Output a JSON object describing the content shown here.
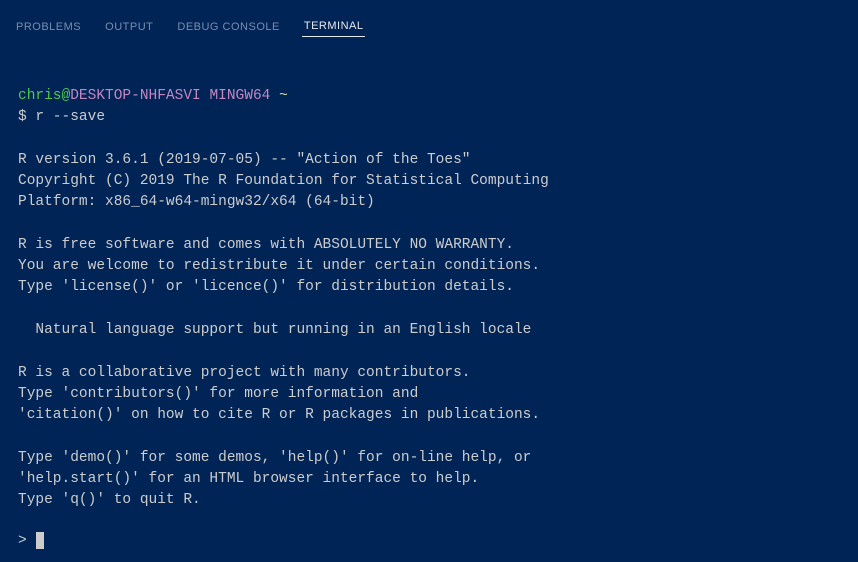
{
  "tabs": {
    "problems": "PROBLEMS",
    "output": "OUTPUT",
    "debug_console": "DEBUG CONSOLE",
    "terminal": "TERMINAL"
  },
  "prompt": {
    "user": "chris",
    "at": "@",
    "host": "DESKTOP-NHFASVI",
    "shell": " MINGW64",
    "path": " ~",
    "symbol": "$ ",
    "command": "r --save"
  },
  "output": {
    "block1": "R version 3.6.1 (2019-07-05) -- \"Action of the Toes\"\nCopyright (C) 2019 The R Foundation for Statistical Computing\nPlatform: x86_64-w64-mingw32/x64 (64-bit)",
    "block2": "R is free software and comes with ABSOLUTELY NO WARRANTY.\nYou are welcome to redistribute it under certain conditions.\nType 'license()' or 'licence()' for distribution details.",
    "block3": "  Natural language support but running in an English locale",
    "block4": "R is a collaborative project with many contributors.\nType 'contributors()' for more information and\n'citation()' on how to cite R or R packages in publications.",
    "block5": "Type 'demo()' for some demos, 'help()' for on-line help, or\n'help.start()' for an HTML browser interface to help.\nType 'q()' to quit R."
  },
  "r_prompt": "> "
}
